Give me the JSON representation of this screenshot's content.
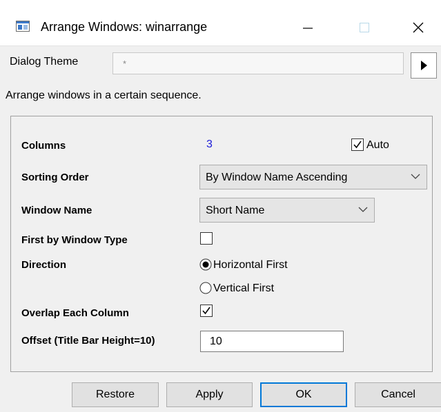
{
  "window": {
    "title": "Arrange Windows: winarrange",
    "app_icon": "window-icon",
    "controls": [
      "minimize-icon",
      "maximize-icon",
      "close-icon"
    ]
  },
  "theme": {
    "label": "Dialog Theme",
    "value": "*",
    "menu_icon": "triangle-right-icon"
  },
  "description": "Arrange windows in a certain sequence.",
  "form": {
    "columns": {
      "label": "Columns",
      "value": "3",
      "auto_label": "Auto",
      "auto_checked": true
    },
    "sorting_order": {
      "label": "Sorting Order",
      "selected": "By Window Name Ascending"
    },
    "window_name": {
      "label": "Window Name",
      "selected": "Short Name"
    },
    "first_by_type": {
      "label": "First by Window Type",
      "checked": false
    },
    "direction": {
      "label": "Direction",
      "options": [
        "Horizontal First",
        "Vertical First"
      ],
      "selected": "Horizontal First"
    },
    "overlap": {
      "label": "Overlap Each Column",
      "checked": true
    },
    "offset": {
      "label": "Offset (Title Bar Height=10)",
      "value": "10"
    }
  },
  "buttons": {
    "restore": "Restore",
    "apply": "Apply",
    "ok": "OK",
    "cancel": "Cancel"
  },
  "colors": {
    "accent": "#0078d7",
    "columns_value": "#1a1ad8",
    "background": "#f0f0f0"
  }
}
